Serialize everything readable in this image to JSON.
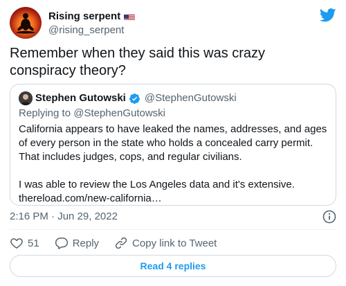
{
  "author": {
    "display_name": "Rising serpent",
    "handle": "@rising_serpent"
  },
  "tweet": {
    "text": "Remember when they said this was crazy conspiracy theory?"
  },
  "quoted": {
    "display_name": "Stephen Gutowski",
    "handle": "@StephenGutowski",
    "replying_to": "Replying to @StephenGutowski",
    "body": "California appears to have leaked the names, addresses, and ages of every person in the state who holds a concealed carry permit. That includes judges, cops, and regular civilians.\n\nI was able to review the Los Angeles data and it's extensive.\nthereload.com/new-california…"
  },
  "timestamp": "2:16 PM · Jun 29, 2022",
  "actions": {
    "like_count": "51",
    "reply_label": "Reply",
    "copy_label": "Copy link to Tweet"
  },
  "read_replies_label": "Read 4 replies",
  "colors": {
    "accent": "#1d9bf0",
    "muted": "#536471",
    "border": "#cfd9de"
  }
}
